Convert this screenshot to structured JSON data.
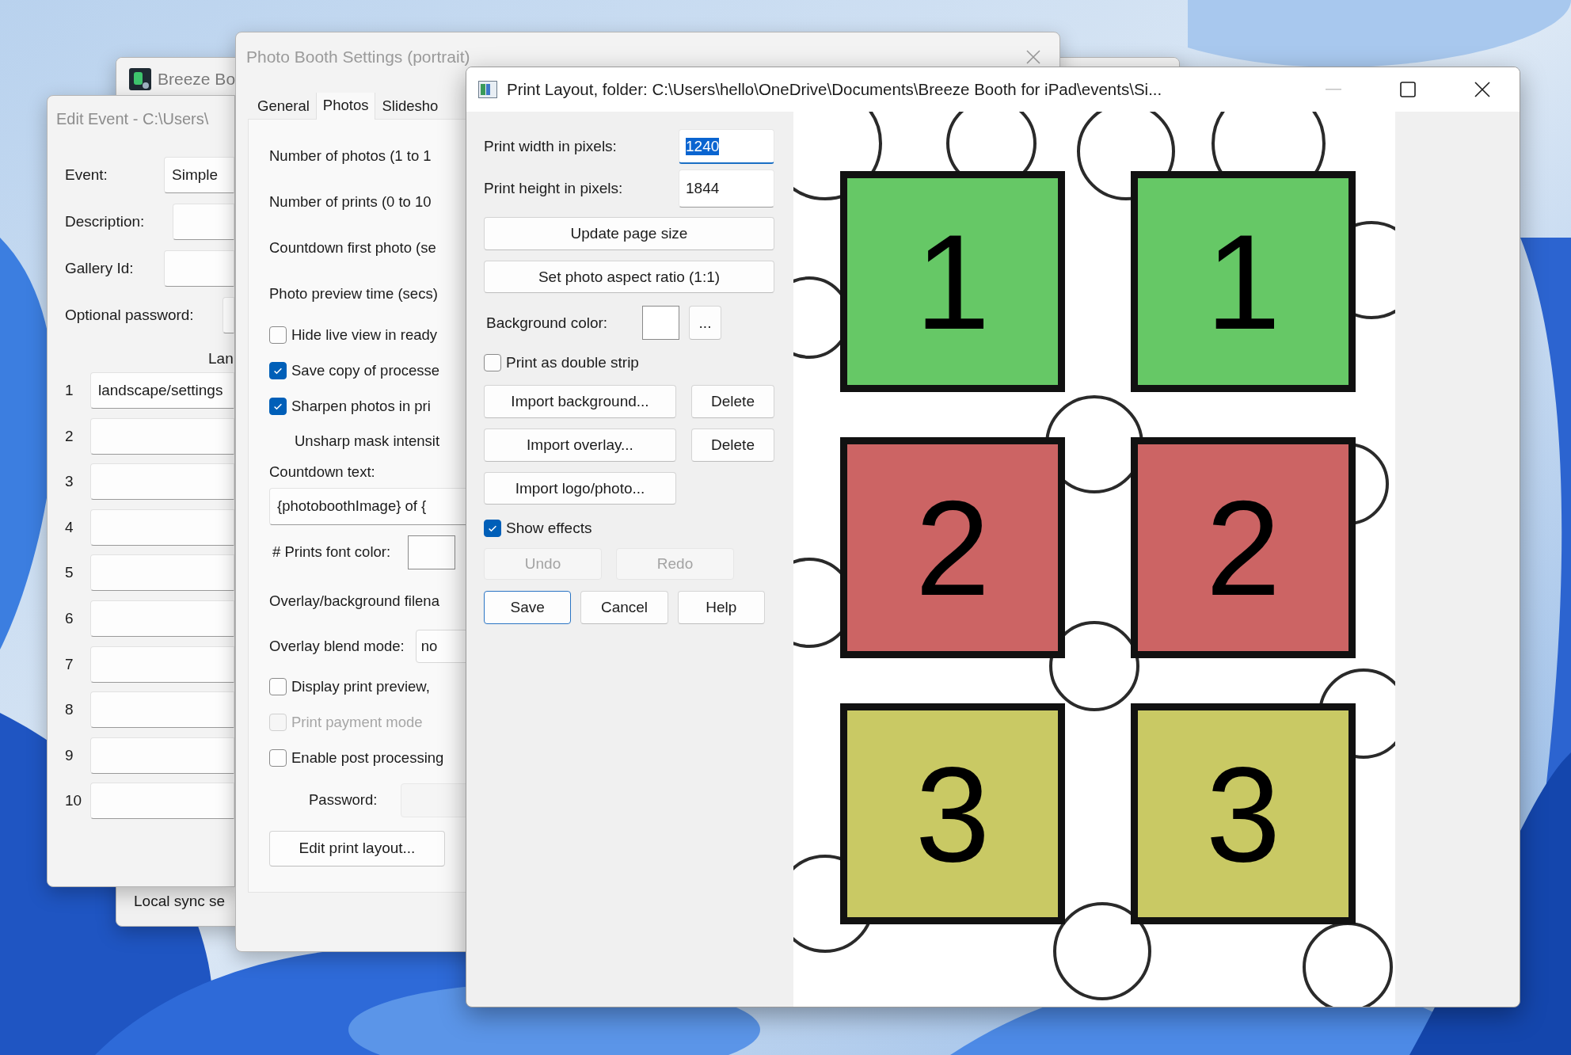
{
  "breeze_window": {
    "title": "Breeze Bo",
    "status_text": "Local sync se"
  },
  "edit_event_window": {
    "title": "Edit Event - C:\\Users\\",
    "fields": [
      {
        "label": "Event:",
        "value": "Simple"
      },
      {
        "label": "Description:"
      },
      {
        "label": "Gallery Id:"
      },
      {
        "label": "Optional password:"
      }
    ],
    "list_header": "Lan",
    "list_rows": [
      {
        "number": "1",
        "value": "landscape/settings"
      },
      {
        "number": "2"
      },
      {
        "number": "3"
      },
      {
        "number": "4"
      },
      {
        "number": "5"
      },
      {
        "number": "6"
      },
      {
        "number": "7"
      },
      {
        "number": "8"
      },
      {
        "number": "9"
      },
      {
        "number": "10"
      }
    ]
  },
  "photo_booth_window": {
    "title": "Photo Booth Settings (portrait)",
    "tabs": [
      {
        "label": "General",
        "selected": false
      },
      {
        "label": "Photos",
        "selected": true
      },
      {
        "label": "Slidesho",
        "selected": false
      }
    ],
    "items": [
      {
        "kind": "label",
        "text": "Number of photos (1 to 1"
      },
      {
        "kind": "label",
        "text": "Number of prints (0 to 10"
      },
      {
        "kind": "label",
        "text": "Countdown first photo (se"
      },
      {
        "kind": "label",
        "text": "Photo preview time (secs)"
      },
      {
        "kind": "checkbox",
        "text": "Hide live view in ready",
        "checked": false,
        "disabled": false
      },
      {
        "kind": "checkbox",
        "text": "Save copy of processe",
        "checked": true,
        "disabled": false
      },
      {
        "kind": "checkbox",
        "text": "Sharpen photos in pri",
        "checked": true,
        "disabled": false
      },
      {
        "kind": "indented",
        "text": "Unsharp mask intensit"
      },
      {
        "kind": "caption",
        "text": "Countdown text:"
      },
      {
        "kind": "field",
        "value": "{photoboothImage} of {"
      },
      {
        "kind": "color",
        "text": "# Prints font color:"
      },
      {
        "kind": "label",
        "text": "Overlay/background filena"
      },
      {
        "kind": "select",
        "text": "Overlay blend mode:",
        "value": "no"
      },
      {
        "kind": "checkbox",
        "text": "Display print preview,",
        "checked": false,
        "disabled": false
      },
      {
        "kind": "checkbox",
        "text": "Print payment mode",
        "checked": false,
        "disabled": true
      },
      {
        "kind": "checkbox",
        "text": "Enable post processing",
        "checked": false,
        "disabled": false
      },
      {
        "kind": "password",
        "text": "Password:"
      },
      {
        "kind": "button",
        "text": "Edit print layout..."
      }
    ]
  },
  "print_layout_window": {
    "title": "Print Layout, folder: C:\\Users\\hello\\OneDrive\\Documents\\Breeze Booth for iPad\\events\\Si...",
    "print_width": {
      "label": "Print width in pixels:",
      "value": "1240",
      "focused": true
    },
    "print_height": {
      "label": "Print height in pixels:",
      "value": "1844",
      "focused": false
    },
    "size_buttons": [
      "Update page size",
      "Set photo aspect ratio (1:1)"
    ],
    "background_color": {
      "label": "Background color:",
      "color": "#ffffff",
      "button": "..."
    },
    "double_strip": {
      "label": "Print as double strip",
      "checked": false
    },
    "import_rows": [
      {
        "button": "Import background...",
        "delete": "Delete"
      },
      {
        "button": "Import overlay...",
        "delete": "Delete"
      },
      {
        "button": "Import logo/photo..."
      }
    ],
    "show_effects": {
      "label": "Show effects",
      "checked": true
    },
    "history_buttons": [
      {
        "label": "Undo",
        "disabled": true
      },
      {
        "label": "Redo",
        "disabled": true
      }
    ],
    "dialog_buttons": [
      {
        "label": "Save",
        "default": true
      },
      {
        "label": "Cancel",
        "default": false
      },
      {
        "label": "Help",
        "default": false
      }
    ],
    "slots": [
      {
        "number": "1",
        "color": "#66c866"
      },
      {
        "number": "1",
        "color": "#66c866"
      },
      {
        "number": "2",
        "color": "#cc6464"
      },
      {
        "number": "2",
        "color": "#cc6464"
      },
      {
        "number": "3",
        "color": "#c9c964"
      },
      {
        "number": "3",
        "color": "#c9c964"
      }
    ]
  }
}
